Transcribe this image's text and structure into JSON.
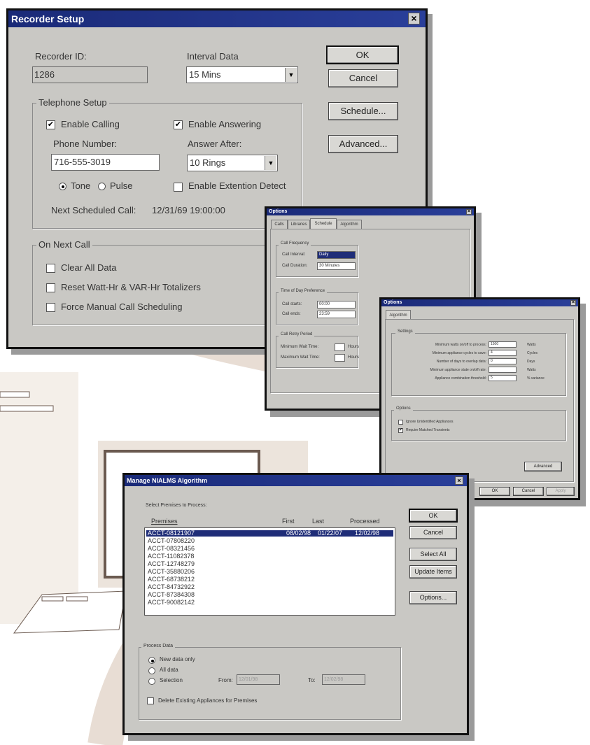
{
  "colors": {
    "titlebar": "#1a2a78",
    "window_bg": "#c9c8c4",
    "selection": "#1f2d78",
    "accent_art": "#e8ddd4"
  },
  "recorder": {
    "title": "Recorder Setup",
    "close": "×",
    "recorder_id_label": "Recorder ID:",
    "recorder_id_value": "1286",
    "interval_label": "Interval Data",
    "interval_value": "15 Mins",
    "ok": "OK",
    "cancel": "Cancel",
    "schedule": "Schedule...",
    "advanced": "Advanced...",
    "telephone_group": "Telephone Setup",
    "enable_calling": "Enable Calling",
    "enable_answering": "Enable Answering",
    "phone_label": "Phone Number:",
    "phone_value": "716-555-3019",
    "answer_after_label": "Answer After:",
    "answer_after_value": "10 Rings",
    "tone": "Tone",
    "pulse": "Pulse",
    "extension_detect": "Enable Extention Detect",
    "next_call_label": "Next Scheduled Call:",
    "next_call_value": "12/31/69 19:00:00",
    "on_next_call_group": "On Next Call",
    "clear_all": "Clear All Data",
    "reset_totalizers": "Reset Watt-Hr & VAR-Hr Totalizers",
    "force_manual": "Force Manual Call Scheduling"
  },
  "options1": {
    "title": "Options",
    "close": "×",
    "tabs": [
      "Calls",
      "Libraries",
      "Schedule",
      "Algorithm"
    ],
    "call_frequency_group": "Call Frequency",
    "call_interval_label": "Call Interval:",
    "call_interval_value": "Daily",
    "call_duration_label": "Call Duration:",
    "call_duration_value": "30 Minutes",
    "time_of_day_group": "Time of Day Preference",
    "call_start_label": "Call starts:",
    "call_start_value": "00:00",
    "call_end_label": "Call ends:",
    "call_end_value": "23:59",
    "call_retry_group": "Call Retry Period",
    "min_wait_label": "Minimum Wait Time:",
    "min_wait_unit": "Hours",
    "max_wait_label": "Maximum Wait Time:",
    "max_wait_unit": "Hours"
  },
  "options2": {
    "title": "Options",
    "close": "×",
    "tabs": [
      "Algorithm"
    ],
    "settings_group": "Settings",
    "settings_rows": [
      {
        "label": "Minimum watts on/off to process:",
        "value": "1500",
        "unit": "Watts"
      },
      {
        "label": "Minimum appliance cycles to save:",
        "value": "4",
        "unit": "Cycles"
      },
      {
        "label": "Number of days to overlap data:",
        "value": "0",
        "unit": "Days"
      },
      {
        "label": "Minimum appliance state on/off rate:",
        "value": "",
        "unit": "Watts"
      },
      {
        "label": "Appliance combination threshold:",
        "value": "5",
        "unit": "% variance"
      }
    ],
    "options_group": "Options",
    "opt1": "Ignore Unidentified Appliances",
    "opt2": "Require Matched Transients",
    "advanced": "Advanced",
    "ok": "OK",
    "cancel": "Cancel",
    "apply": "Apply"
  },
  "nialms": {
    "title": "Manage NIALMS Algorithm",
    "close": "×",
    "select_label": "Select Premises to Process:",
    "col_premises": "Premises",
    "col_first": "First",
    "col_last": "Last",
    "col_processed": "Processed",
    "rows": [
      {
        "name": "ACCT-08121907",
        "first": "08/02/98",
        "last": "01/22/07",
        "processed": "12/02/98"
      },
      {
        "name": "ACCT-07808220",
        "first": "",
        "last": "",
        "processed": ""
      },
      {
        "name": "ACCT-08321456",
        "first": "",
        "last": "",
        "processed": ""
      },
      {
        "name": "ACCT-11082378",
        "first": "",
        "last": "",
        "processed": ""
      },
      {
        "name": "ACCT-12748279",
        "first": "",
        "last": "",
        "processed": ""
      },
      {
        "name": "ACCT-35880206",
        "first": "",
        "last": "",
        "processed": ""
      },
      {
        "name": "ACCT-68738212",
        "first": "",
        "last": "",
        "processed": ""
      },
      {
        "name": "ACCT-84732922",
        "first": "",
        "last": "",
        "processed": ""
      },
      {
        "name": "ACCT-87384308",
        "first": "",
        "last": "",
        "processed": ""
      },
      {
        "name": "ACCT-90082142",
        "first": "",
        "last": "",
        "processed": ""
      }
    ],
    "ok": "OK",
    "cancel": "Cancel",
    "select_all": "Select All",
    "update_items": "Update Items",
    "options": "Options...",
    "process_group": "Process Data",
    "new_data_only": "New data only",
    "all_data": "All data",
    "selection": "Selection",
    "from_label": "From:",
    "from_value": "12/01/98",
    "to_label": "To:",
    "to_value": "12/02/98",
    "delete_existing": "Delete Existing Appliances for Premises"
  }
}
